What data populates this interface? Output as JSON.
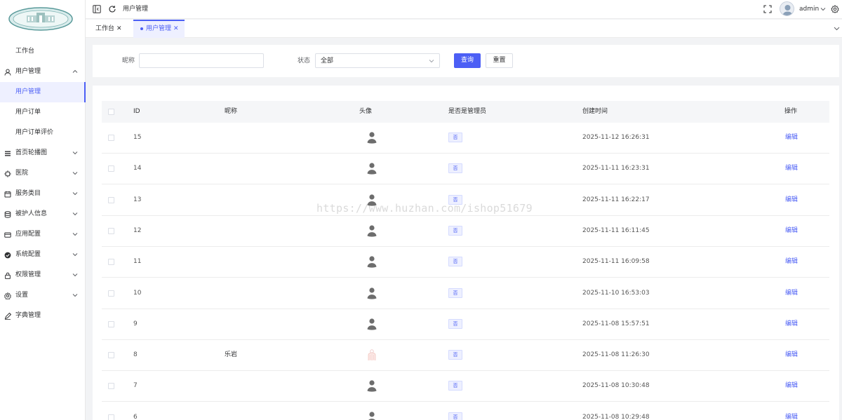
{
  "sidebar": {
    "items": [
      {
        "label": "工作台",
        "icon": "none"
      },
      {
        "label": "用户管理",
        "icon": "user-icon",
        "expanded": true
      },
      {
        "label": "用户管理",
        "sub": true,
        "active": true
      },
      {
        "label": "用户订单",
        "sub": true
      },
      {
        "label": "用户订单评价",
        "sub": true
      },
      {
        "label": "首页轮播图",
        "icon": "menu-lines-icon"
      },
      {
        "label": "医院",
        "icon": "chip-icon"
      },
      {
        "label": "服务类目",
        "icon": "calendar-icon"
      },
      {
        "label": "被护人信息",
        "icon": "database-icon"
      },
      {
        "label": "应用配置",
        "icon": "card-icon"
      },
      {
        "label": "系统配置",
        "icon": "check-circle-icon"
      },
      {
        "label": "权限管理",
        "icon": "lock-icon"
      },
      {
        "label": "设置",
        "icon": "gear-icon"
      },
      {
        "label": "字典管理",
        "icon": "pen-icon"
      }
    ]
  },
  "topbar": {
    "breadcrumb": "用户管理",
    "username": "admin"
  },
  "tabs": [
    {
      "label": "工作台",
      "active": false
    },
    {
      "label": "用户管理",
      "active": true
    }
  ],
  "search": {
    "nickname_label": "昵称",
    "nickname_value": "",
    "status_label": "状态",
    "status_value": "全部",
    "query_button": "查询",
    "reset_button": "重置"
  },
  "table": {
    "headers": {
      "id": "ID",
      "nickname": "昵称",
      "avatar": "头像",
      "is_admin": "是否是管理员",
      "created": "创建时间",
      "action": "操作"
    },
    "rows": [
      {
        "id": "15",
        "nickname": "",
        "avatar": "default",
        "is_admin": "否",
        "created": "2025-11-12 16:26:31",
        "action": "编辑"
      },
      {
        "id": "14",
        "nickname": "",
        "avatar": "default",
        "is_admin": "否",
        "created": "2025-11-11 16:23:31",
        "action": "编辑"
      },
      {
        "id": "13",
        "nickname": "",
        "avatar": "default",
        "is_admin": "否",
        "created": "2025-11-11 16:22:17",
        "action": "编辑"
      },
      {
        "id": "12",
        "nickname": "",
        "avatar": "default",
        "is_admin": "否",
        "created": "2025-11-11 16:11:45",
        "action": "编辑"
      },
      {
        "id": "11",
        "nickname": "",
        "avatar": "default",
        "is_admin": "否",
        "created": "2025-11-11 16:09:58",
        "action": "编辑"
      },
      {
        "id": "10",
        "nickname": "",
        "avatar": "default",
        "is_admin": "否",
        "created": "2025-11-10 16:53:03",
        "action": "编辑"
      },
      {
        "id": "9",
        "nickname": "",
        "avatar": "default",
        "is_admin": "否",
        "created": "2025-11-08 15:57:51",
        "action": "编辑"
      },
      {
        "id": "8",
        "nickname": "乐岩",
        "avatar": "custom",
        "is_admin": "否",
        "created": "2025-11-08 11:26:30",
        "action": "编辑"
      },
      {
        "id": "7",
        "nickname": "",
        "avatar": "default",
        "is_admin": "否",
        "created": "2025-11-08 10:30:48",
        "action": "编辑"
      },
      {
        "id": "6",
        "nickname": "",
        "avatar": "default",
        "is_admin": "否",
        "created": "2025-11-08 10:29:48",
        "action": "编辑"
      }
    ]
  },
  "watermark": "https://www.huzhan.com/ishop51679",
  "colors": {
    "accent": "#4c5ff5",
    "accent_bg": "#eef0ff",
    "page_bg": "#f2f3f5"
  }
}
